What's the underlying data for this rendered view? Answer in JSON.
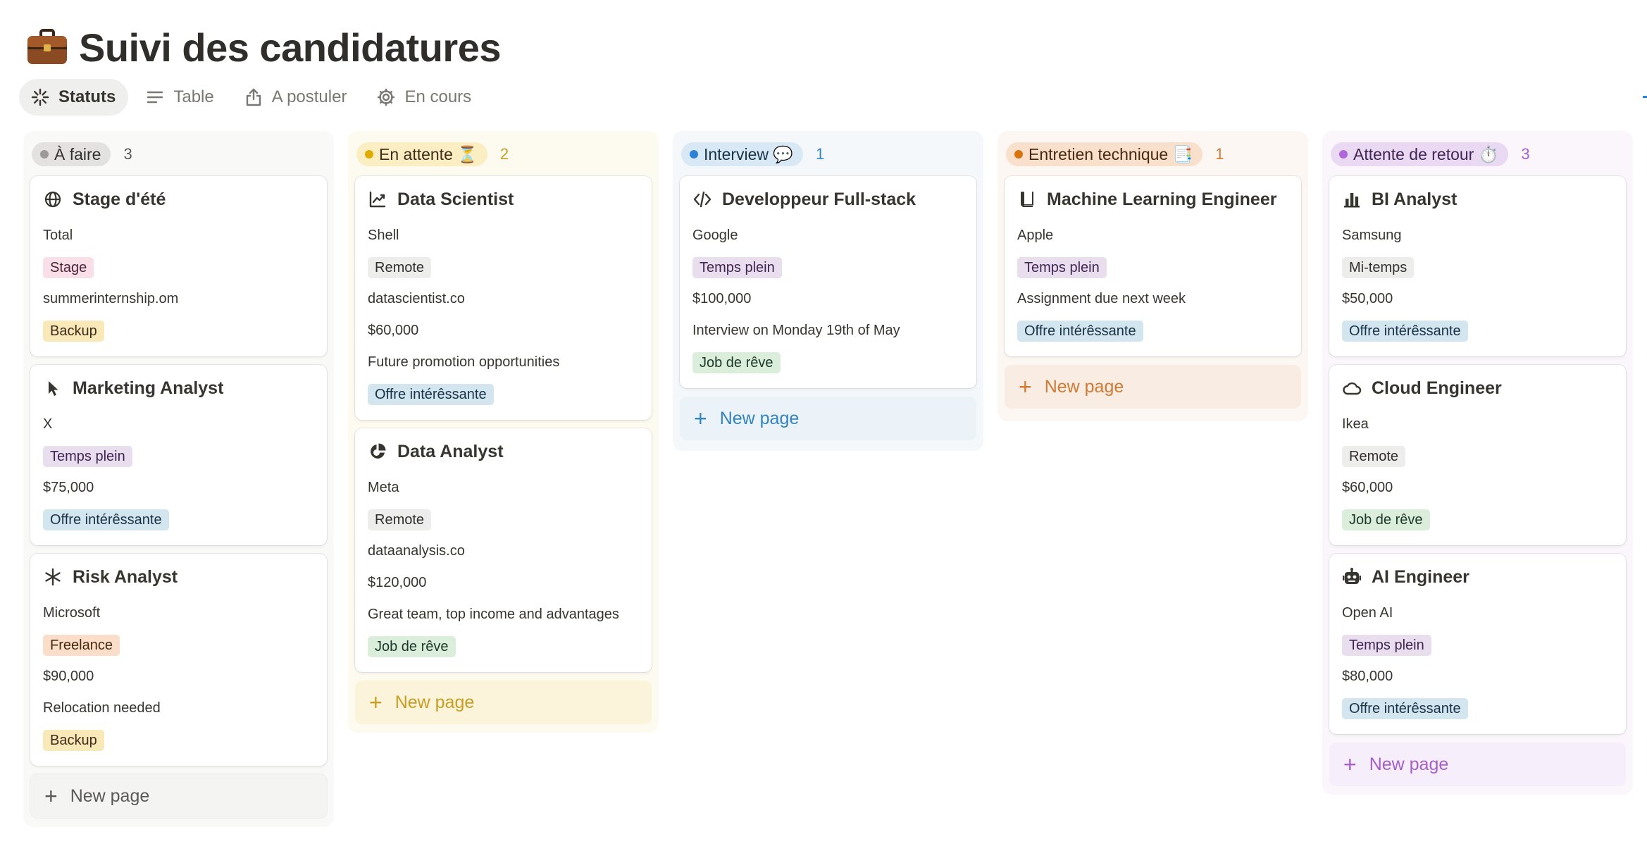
{
  "page": {
    "title": "Suivi des candidatures",
    "emoji": "briefcase"
  },
  "views": [
    {
      "label": "Statuts",
      "icon": "loading-spinner-icon",
      "active": true
    },
    {
      "label": "Table",
      "icon": "lines-icon",
      "active": false
    },
    {
      "label": "A postuler",
      "icon": "share-up-icon",
      "active": false
    },
    {
      "label": "En cours",
      "icon": "gear-icon",
      "active": false
    }
  ],
  "new_page_label": "New page",
  "columns": [
    {
      "status": "À faire",
      "count": "3",
      "color": "#9b9a97",
      "cards": [
        {
          "icon": "globe-icon",
          "title": "Stage d'été",
          "company": "Total",
          "type": "Stage",
          "link": "summerinternship.om",
          "tag": "Backup"
        },
        {
          "icon": "cursor-icon",
          "title": "Marketing Analyst",
          "company": "X",
          "type": "Temps plein",
          "salary": "$75,000",
          "tag": "Offre intérêssante"
        },
        {
          "icon": "asterisk-icon",
          "title": "Risk Analyst",
          "company": "Microsoft",
          "type": "Freelance",
          "salary": "$90,000",
          "note": "Relocation needed",
          "tag": "Backup"
        }
      ]
    },
    {
      "status": "En attente ⏳",
      "count": "2",
      "color": "#dfab01",
      "cards": [
        {
          "icon": "chart-line-icon",
          "title": "Data Scientist",
          "company": "Shell",
          "type": "Remote",
          "link": "datascientist.co",
          "salary": "$60,000",
          "note": "Future promotion opportunities",
          "tag": "Offre intérêssante"
        },
        {
          "icon": "pie-chart-icon",
          "title": "Data Analyst",
          "company": "Meta",
          "type": "Remote",
          "link": "dataanalysis.co",
          "salary": "$120,000",
          "note": "Great team, top income and advantages",
          "tag": "Job de rêve"
        }
      ]
    },
    {
      "status": "Interview 💬",
      "count": "1",
      "color": "#2e82d6",
      "cards": [
        {
          "icon": "code-icon",
          "title": "Developpeur Full-stack",
          "company": "Google",
          "type": "Temps plein",
          "salary": "$100,000",
          "note": "Interview on Monday 19th of May",
          "tag": "Job de rêve"
        }
      ]
    },
    {
      "status": "Entretien technique 📑",
      "count": "1",
      "color": "#d9730d",
      "cards": [
        {
          "icon": "book-icon",
          "title": "Machine Learning Engineer",
          "company": "Apple",
          "type": "Temps plein",
          "note": "Assignment due next week",
          "tag": "Offre intérêssante"
        }
      ]
    },
    {
      "status": "Attente de retour ⏱️",
      "count": "3",
      "color": "#b065d9",
      "cards": [
        {
          "icon": "bar-chart-icon",
          "title": "BI Analyst",
          "company": "Samsung",
          "type": "Mi-temps",
          "salary": "$50,000",
          "tag": "Offre intérêssante"
        },
        {
          "icon": "cloud-icon",
          "title": "Cloud Engineer",
          "company": "Ikea",
          "type": "Remote",
          "salary": "$60,000",
          "tag": "Job de rêve"
        },
        {
          "icon": "robot-icon",
          "title": "AI Engineer",
          "company": "Open AI",
          "type": "Temps plein",
          "salary": "$80,000",
          "tag": "Offre intérêssante"
        }
      ]
    }
  ]
}
